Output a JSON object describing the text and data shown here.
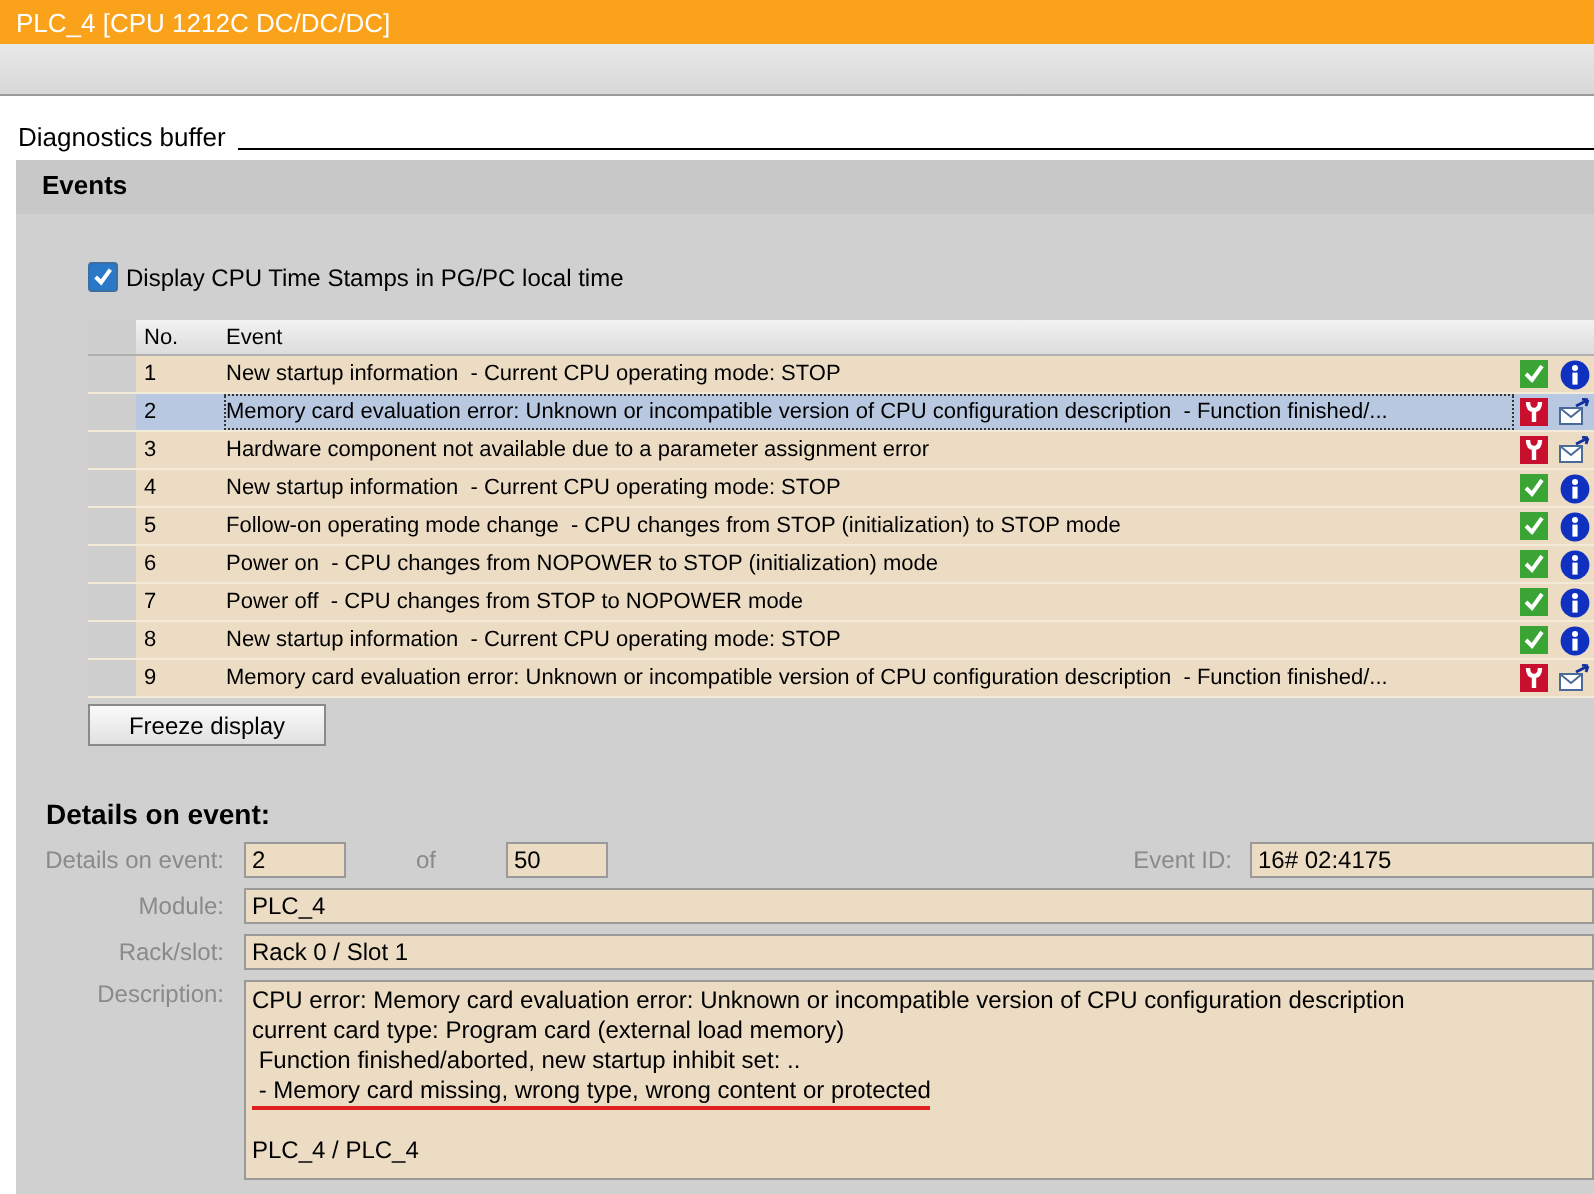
{
  "window": {
    "title": "PLC_4 [CPU 1212C DC/DC/DC]"
  },
  "section_title": "Diagnostics buffer",
  "events": {
    "title": "Events",
    "timestamp_option": {
      "label": "Display CPU Time Stamps in PG/PC local time",
      "checked": true
    },
    "columns": [
      "No.",
      "Event"
    ],
    "rows": [
      {
        "no": "1",
        "event": "New startup information  - Current CPU operating mode: STOP",
        "kind": "info",
        "selected": false
      },
      {
        "no": "2",
        "event": "Memory card evaluation error: Unknown or incompatible version of CPU configuration description  - Function finished/...",
        "kind": "error",
        "selected": true
      },
      {
        "no": "3",
        "event": "Hardware component not available due to a parameter assignment error",
        "kind": "error",
        "selected": false
      },
      {
        "no": "4",
        "event": "New startup information  - Current CPU operating mode: STOP",
        "kind": "info",
        "selected": false
      },
      {
        "no": "5",
        "event": "Follow-on operating mode change  - CPU changes from STOP (initialization) to STOP mode",
        "kind": "info",
        "selected": false
      },
      {
        "no": "6",
        "event": "Power on  - CPU changes from NOPOWER to STOP (initialization) mode",
        "kind": "info",
        "selected": false
      },
      {
        "no": "7",
        "event": "Power off  - CPU changes from STOP to NOPOWER mode",
        "kind": "info",
        "selected": false
      },
      {
        "no": "8",
        "event": "New startup information  - Current CPU operating mode: STOP",
        "kind": "info",
        "selected": false
      },
      {
        "no": "9",
        "event": "Memory card evaluation error: Unknown or incompatible version of CPU configuration description  - Function finished/...",
        "kind": "error",
        "selected": false
      }
    ],
    "freeze_button": "Freeze display"
  },
  "details": {
    "title": "Details on event:",
    "event_label": "Details on event:",
    "event_number": "2",
    "of_label": "of",
    "event_total": "50",
    "event_id_label": "Event ID:",
    "event_id": "16# 02:4175",
    "module_label": "Module:",
    "module": "PLC_4",
    "rack_label": "Rack/slot:",
    "rack": "Rack 0 / Slot 1",
    "description_label": "Description:",
    "description_lines": [
      {
        "text": "CPU error: Memory card evaluation error: Unknown or incompatible version of CPU configuration description",
        "underlined": false
      },
      {
        "text": "current card type: Program card (external load memory)",
        "underlined": false
      },
      {
        "text": " Function finished/aborted, new startup inhibit set: ..",
        "underlined": false
      },
      {
        "text": " - Memory card missing, wrong type, wrong content or protected",
        "underlined": true
      },
      {
        "text": "PLC_4 / PLC_4",
        "underlined": false
      }
    ]
  }
}
